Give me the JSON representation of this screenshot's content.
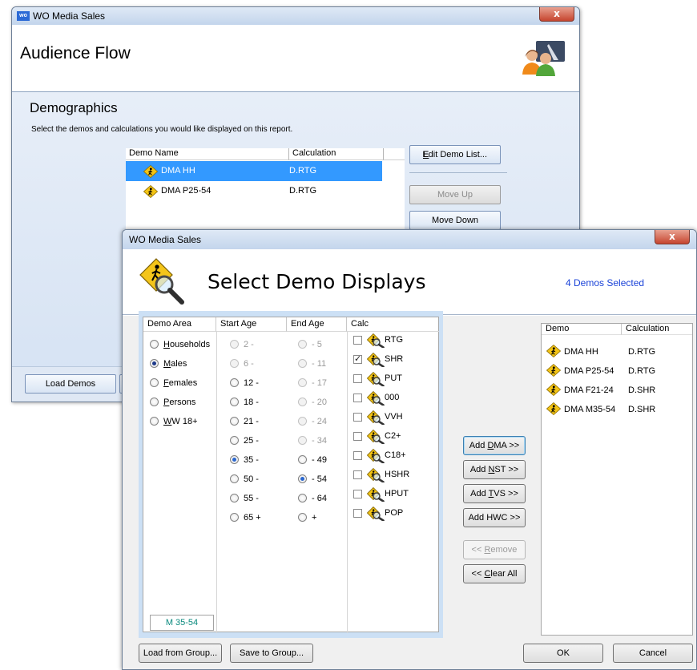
{
  "back_window": {
    "title": "WO Media Sales",
    "app_icon_text": "wo",
    "close_glyph": "x",
    "header_title": "Audience Flow",
    "section_title": "Demographics",
    "description": "Select the demos and calculations you would like displayed on this report.",
    "grid_headers": {
      "name": "Demo Name",
      "calc": "Calculation"
    },
    "rows": [
      {
        "name": "DMA HH",
        "calc": "D.RTG",
        "selected": true
      },
      {
        "name": "DMA P25-54",
        "calc": "D.RTG",
        "selected": false
      }
    ],
    "buttons": {
      "edit_demo_list": "Edit Demo List...",
      "move_up": "Move Up",
      "move_down": "Move Down",
      "load_demos": "Load Demos"
    }
  },
  "dialog": {
    "title": "WO Media Sales",
    "close_glyph": "x",
    "header_title": "Select Demo Displays",
    "selected_count": "4 Demos Selected",
    "columns": {
      "demo_area": "Demo Area",
      "start_age": "Start Age",
      "end_age": "End Age",
      "calc": "Calc"
    },
    "demo_areas": [
      {
        "label": "Households",
        "mnemonic": "H",
        "checked": false
      },
      {
        "label": "Males",
        "mnemonic": "M",
        "checked": true
      },
      {
        "label": "Females",
        "mnemonic": "F",
        "checked": false
      },
      {
        "label": "Persons",
        "mnemonic": "P",
        "checked": false
      },
      {
        "label": "WW 18+",
        "mnemonic": "W",
        "checked": false
      }
    ],
    "start_ages": [
      {
        "label": "2 -",
        "enabled": false,
        "checked": false
      },
      {
        "label": "6 -",
        "enabled": false,
        "checked": false
      },
      {
        "label": "12 -",
        "enabled": true,
        "checked": false
      },
      {
        "label": "18 -",
        "enabled": true,
        "checked": false
      },
      {
        "label": "21 -",
        "enabled": true,
        "checked": false
      },
      {
        "label": "25 -",
        "enabled": true,
        "checked": false
      },
      {
        "label": "35 -",
        "enabled": true,
        "checked": true
      },
      {
        "label": "50 -",
        "enabled": true,
        "checked": false
      },
      {
        "label": "55 -",
        "enabled": true,
        "checked": false
      },
      {
        "label": "65 +",
        "enabled": true,
        "checked": false
      }
    ],
    "end_ages": [
      {
        "label": "- 5",
        "enabled": false,
        "checked": false
      },
      {
        "label": "- 11",
        "enabled": false,
        "checked": false
      },
      {
        "label": "- 17",
        "enabled": false,
        "checked": false
      },
      {
        "label": "- 20",
        "enabled": false,
        "checked": false
      },
      {
        "label": "- 24",
        "enabled": false,
        "checked": false
      },
      {
        "label": "- 34",
        "enabled": false,
        "checked": false
      },
      {
        "label": "- 49",
        "enabled": true,
        "checked": false
      },
      {
        "label": "- 54",
        "enabled": true,
        "checked": true
      },
      {
        "label": "- 64",
        "enabled": true,
        "checked": false
      },
      {
        "label": "+",
        "enabled": true,
        "checked": false
      }
    ],
    "calcs": [
      {
        "label": "RTG",
        "checked": false
      },
      {
        "label": "SHR",
        "checked": true
      },
      {
        "label": "PUT",
        "checked": false
      },
      {
        "label": "000",
        "checked": false
      },
      {
        "label": "VVH",
        "checked": false
      },
      {
        "label": "C2+",
        "checked": false
      },
      {
        "label": "C18+",
        "checked": false
      },
      {
        "label": "HSHR",
        "checked": false
      },
      {
        "label": "HPUT",
        "checked": false
      },
      {
        "label": "POP",
        "checked": false
      }
    ],
    "demo_summary": "M 35-54",
    "middle_buttons": [
      {
        "label": "Add DMA >>",
        "mnemonic": "D",
        "enabled": true,
        "focused": true
      },
      {
        "label": "Add NST >>",
        "mnemonic": "N",
        "enabled": true,
        "focused": false
      },
      {
        "label": "Add TVS >>",
        "mnemonic": "T",
        "enabled": true,
        "focused": false
      },
      {
        "label": "Add HWC >>",
        "mnemonic": "",
        "enabled": true,
        "focused": false
      },
      {
        "label": "<< Remove",
        "mnemonic": "R",
        "enabled": false,
        "focused": false
      },
      {
        "label": "<< Clear All",
        "mnemonic": "C",
        "enabled": true,
        "focused": false
      }
    ],
    "selected_headers": {
      "demo": "Demo",
      "calc": "Calculation"
    },
    "selected_demos": [
      {
        "demo": "DMA HH",
        "calc": "D.RTG"
      },
      {
        "demo": "DMA P25-54",
        "calc": "D.RTG"
      },
      {
        "demo": "DMA F21-24",
        "calc": "D.SHR"
      },
      {
        "demo": "DMA M35-54",
        "calc": "D.SHR"
      }
    ],
    "footer": {
      "load_from_group": "Load from Group...",
      "save_to_group": "Save to Group...",
      "ok": "OK",
      "cancel": "Cancel"
    }
  }
}
